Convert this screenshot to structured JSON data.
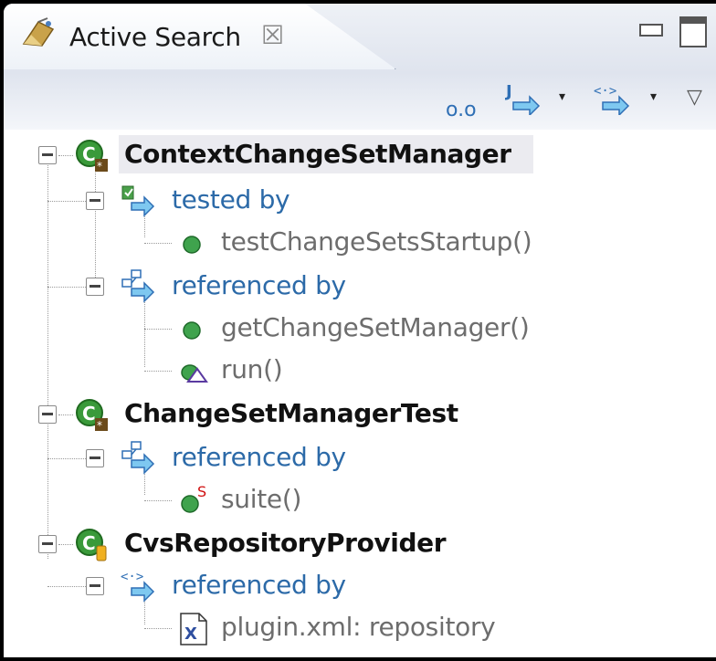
{
  "view": {
    "title": "Active Search",
    "close_glyph": "☒",
    "icon": "active-search-icon"
  },
  "toolbar": {
    "link_glyph": "o.o",
    "dropdown_glyph": "▾",
    "menu_glyph": "▽"
  },
  "tree": [
    {
      "label": "ContextChangeSetManager",
      "kind": "class",
      "selected": true,
      "groups": [
        {
          "label": "tested by",
          "icon": "test-relation-icon",
          "children": [
            {
              "label": "testChangeSetsStartup()",
              "icon": "public-method-icon"
            }
          ]
        },
        {
          "label": "referenced by",
          "icon": "reference-relation-icon",
          "children": [
            {
              "label": "getChangeSetManager()",
              "icon": "public-method-icon"
            },
            {
              "label": "run()",
              "icon": "default-method-icon"
            }
          ]
        }
      ]
    },
    {
      "label": "ChangeSetManagerTest",
      "kind": "class",
      "selected": false,
      "groups": [
        {
          "label": "referenced by",
          "icon": "reference-relation-icon",
          "children": [
            {
              "label": "suite()",
              "icon": "static-method-icon"
            }
          ]
        }
      ]
    },
    {
      "label": "CvsRepositoryProvider",
      "kind": "class",
      "selected": false,
      "groups": [
        {
          "label": "referenced by",
          "icon": "xml-reference-relation-icon",
          "children": [
            {
              "label": "plugin.xml: repository",
              "icon": "xml-file-icon"
            }
          ]
        }
      ]
    }
  ],
  "colors": {
    "relation_text": "#2c6aa8",
    "member_text": "#6d6d6d",
    "class_icon": "#3a9a3a"
  }
}
